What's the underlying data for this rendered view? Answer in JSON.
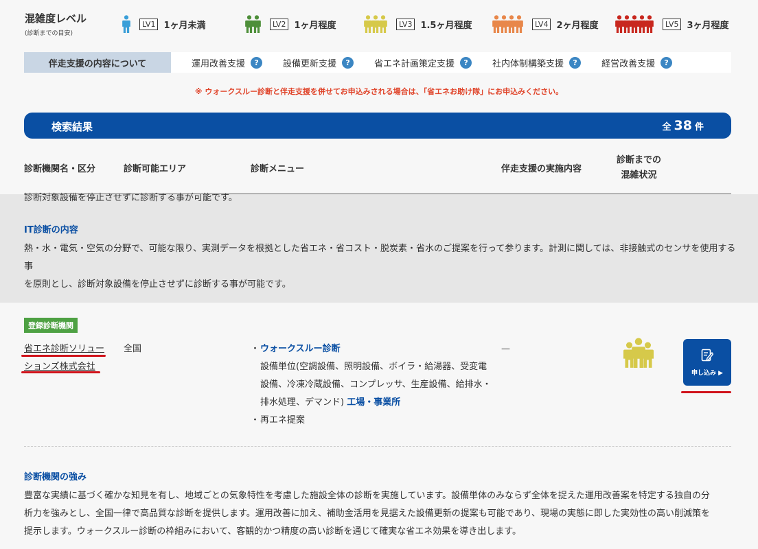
{
  "legend": {
    "title": "混雑度レベル",
    "subtitle": "(診断までの目安)",
    "levels": [
      {
        "badge": "LV1",
        "text": "1ヶ月未満",
        "color": "#3b9fd8",
        "count": 1
      },
      {
        "badge": "LV2",
        "text": "1ヶ月程度",
        "color": "#4e8f3a",
        "count": 2
      },
      {
        "badge": "LV3",
        "text": "1.5ヶ月程度",
        "color": "#d6c94a",
        "count": 3
      },
      {
        "badge": "LV4",
        "text": "2ヶ月程度",
        "color": "#e8874a",
        "count": 4
      },
      {
        "badge": "LV5",
        "text": "3ヶ月程度",
        "color": "#c8281f",
        "count": 5
      }
    ]
  },
  "support": {
    "heading": "伴走支援の内容について",
    "items": [
      "運用改善支援",
      "設備更新支援",
      "省エネ計画策定支援",
      "社内体制構築支援",
      "経営改善支援"
    ],
    "help_glyph": "?"
  },
  "notice": "※ ウォークスルー診断と伴走支援を併せてお申込みされる場合は、「省エネお助け隊」にお申込みください。",
  "results": {
    "title": "検索結果",
    "prefix": "全",
    "count": "38",
    "suffix": "件"
  },
  "columns": {
    "name": "診断機関名・区分",
    "area": "診断可能エリア",
    "menu": "診断メニュー",
    "support": "伴走支援の実施内容",
    "congestion_line1": "診断までの",
    "congestion_line2": "混雑状況"
  },
  "prev_entry": {
    "tail_text": "診断対象設備を停止させずに診断する事が可能です。",
    "it_heading": "IT診断の内容",
    "it_line1": "熱・水・電気・空気の分野で、可能な限り、実測データを根拠とした省エネ・省コスト・脱炭素・省水のご提案を行って参ります。計測に関しては、非接触式のセンサを使用する事",
    "it_line2": "を原則とし、診断対象設備を停止させずに診断する事が可能です。"
  },
  "entry": {
    "badge": "登録診断機関",
    "company_line1": "省エネ診断ソリュー",
    "company_line2": "ションズ株式会社",
    "area": "全国",
    "bullet": "・",
    "menu_title": "ウォークスルー診断",
    "menu_detail1": "設備単位(空調設備、照明設備、ボイラ・給湯器、受変電",
    "menu_detail2": "設備、冷凍冷蔵設備、コンプレッサ、生産設備、給排水・",
    "menu_detail3": "排水処理、デマンド)",
    "menu_target": "工場・事業所",
    "menu_item2": "再エネ提案",
    "support_value": "—",
    "congestion_level": 3,
    "congestion_color": "#d6c94a",
    "apply_label": "申し込み ▶",
    "strengths_heading": "診断機関の強み",
    "strengths_line1": "豊富な実績に基づく確かな知見を有し、地域ごとの気象特性を考慮した施設全体の診断を実施しています。設備単体のみならず全体を捉えた運用改善案を特定する独自の分",
    "strengths_line2": "析力を強みとし、全国一律で高品質な診断を提供します。運用改善に加え、補助金活用を見据えた設備更新の提案も可能であり、現場の実態に即した実効性の高い削減策を",
    "strengths_line3": "提示します。ウォークスルー診断の枠組みにおいて、客観的かつ精度の高い診断を通じて確実な省エネ効果を導き出します。"
  }
}
